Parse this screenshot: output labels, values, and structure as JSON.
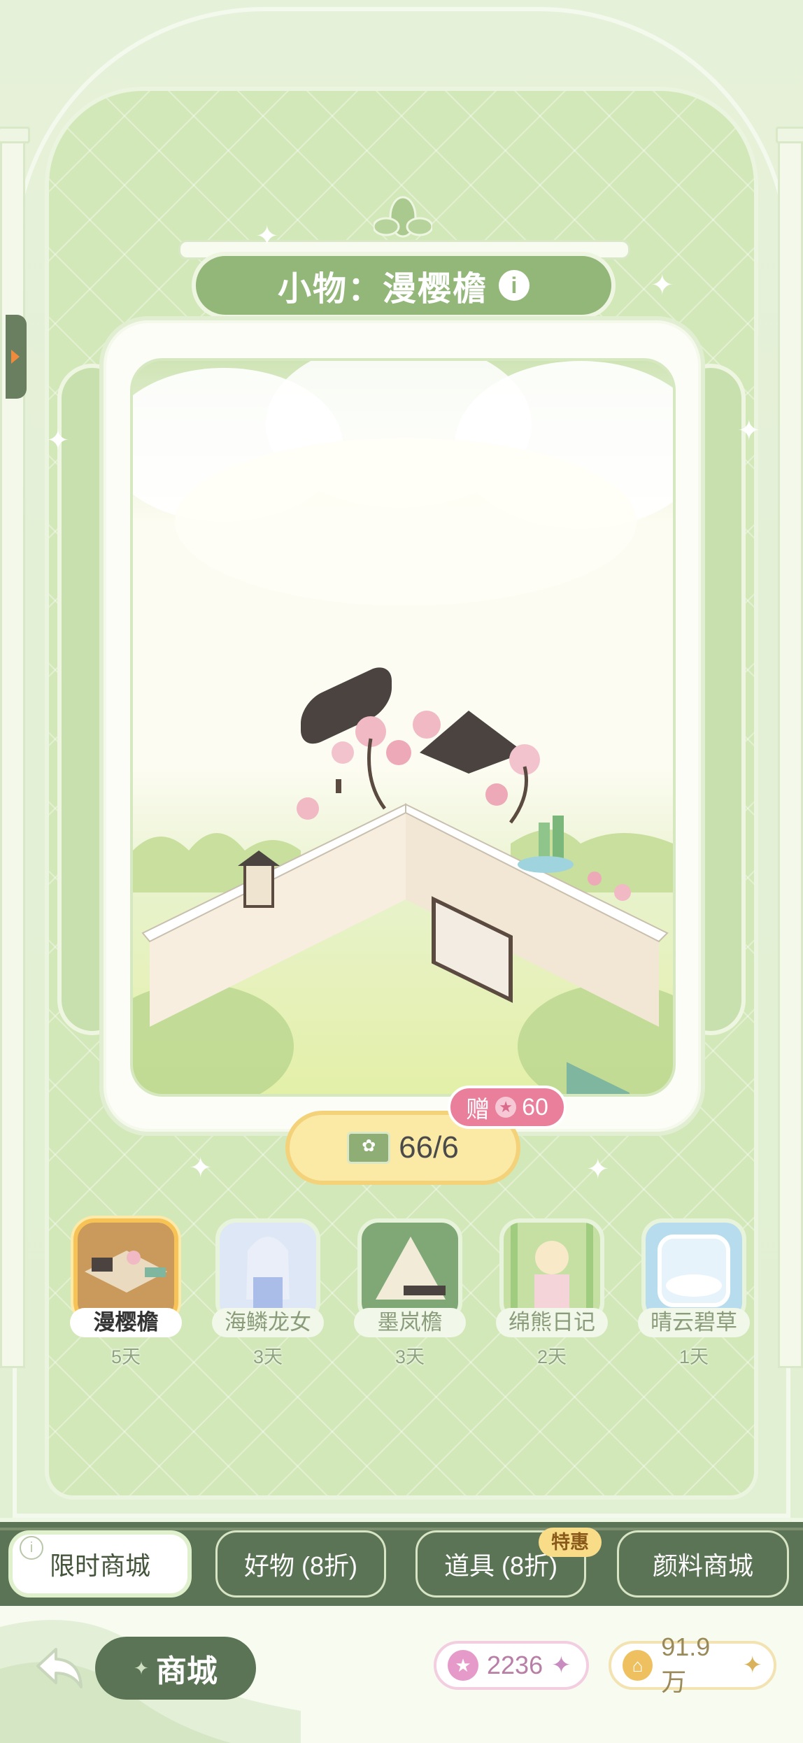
{
  "header": {
    "title": "小物：漫樱檐"
  },
  "price": {
    "amount": "66/6",
    "gift_prefix": "赠",
    "gift_amount": "60"
  },
  "items": [
    {
      "name": "漫樱檐",
      "days": "5天",
      "selected": true
    },
    {
      "name": "海鳞龙女",
      "days": "3天",
      "selected": false
    },
    {
      "name": "墨岚檐",
      "days": "3天",
      "selected": false
    },
    {
      "name": "绵熊日记",
      "days": "2天",
      "selected": false
    },
    {
      "name": "晴云碧草",
      "days": "1天",
      "selected": false
    }
  ],
  "tabs": [
    {
      "label": "限时商城",
      "active": true
    },
    {
      "label": "好物 (8折)",
      "active": false
    },
    {
      "label": "道具 (8折)",
      "active": false
    },
    {
      "label": "颜料商城",
      "active": false
    }
  ],
  "promo_badge": "特惠",
  "bottom": {
    "back_icon": "back-arrow-icon",
    "mall_label": "商城",
    "star_currency": "2236",
    "coin_currency": "91.9万"
  },
  "colors": {
    "accent_green": "#5c7456",
    "panel_green": "#d2e8b9",
    "gift_pink": "#ea7f9c",
    "price_gold": "#fbe9a6"
  }
}
